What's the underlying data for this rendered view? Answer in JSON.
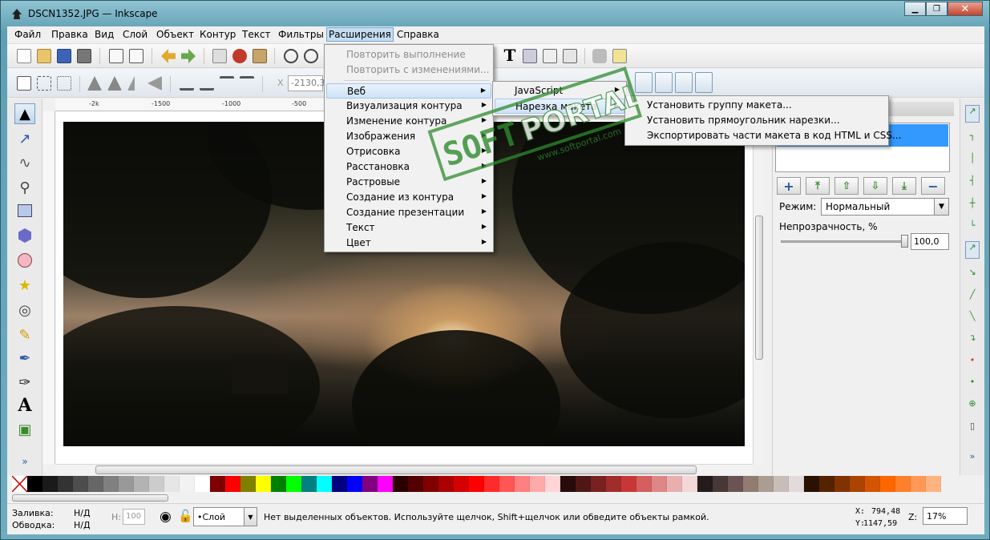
{
  "window": {
    "title": "DSCN1352.JPG — Inkscape",
    "minimize": "▁",
    "maximize": "❐",
    "close": "✕"
  },
  "menubar": [
    "Файл",
    "Правка",
    "Вид",
    "Слой",
    "Объект",
    "Контур",
    "Текст",
    "Фильтры",
    "Расширения",
    "Справка"
  ],
  "toolbar2": {
    "x_label": "X",
    "x_value": "-2130,3!"
  },
  "ruler": {
    "ticks": [
      "-2k",
      "-1500",
      "-1000",
      "-500"
    ]
  },
  "extensions_menu": {
    "items": [
      {
        "label": "Повторить выполнение",
        "disabled": true
      },
      {
        "label": "Повторить с изменениями...",
        "disabled": true
      },
      {
        "label": "Веб",
        "submenu": true
      },
      {
        "label": "Визуализация контура",
        "submenu": true
      },
      {
        "label": "Изменение контура",
        "submenu": true
      },
      {
        "label": "Изображения",
        "submenu": true
      },
      {
        "label": "Отрисовка",
        "submenu": true
      },
      {
        "label": "Расстановка",
        "submenu": true
      },
      {
        "label": "Растровые",
        "submenu": true
      },
      {
        "label": "Создание из контура",
        "submenu": true
      },
      {
        "label": "Создание презентации",
        "submenu": true
      },
      {
        "label": "Текст",
        "submenu": true
      },
      {
        "label": "Цвет",
        "submenu": true
      }
    ]
  },
  "web_submenu": {
    "items": [
      "JavaScript",
      "Нарезка макета"
    ]
  },
  "slicing_submenu": {
    "items": [
      "Установить группу макета...",
      "Установить прямоугольник нарезки...",
      "Экспортировать части макета в код HTML и CSS..."
    ]
  },
  "layers_panel": {
    "mode_label": "Режим:",
    "mode_value": "Нормальный",
    "opacity_label": "Непрозрачность, %",
    "opacity_value": "100,0",
    "opacity_fraction": 1.0,
    "buttons": [
      "+",
      "⤒",
      "⇧",
      "⇩",
      "⤓",
      "−"
    ]
  },
  "palette_colors": [
    "#000000",
    "#1a1a1a",
    "#333333",
    "#4d4d4d",
    "#666666",
    "#808080",
    "#999999",
    "#b3b3b3",
    "#cccccc",
    "#e6e6e6",
    "#f2f2f2",
    "#ffffff",
    "#800000",
    "#ff0000",
    "#808000",
    "#ffff00",
    "#008000",
    "#00ff00",
    "#008080",
    "#00ffff",
    "#000080",
    "#0000ff",
    "#800080",
    "#ff00ff",
    "#2b0000",
    "#550000",
    "#800000",
    "#aa0000",
    "#d40000",
    "#ff0000",
    "#ff2a2a",
    "#ff5555",
    "#ff8080",
    "#ffaaaa",
    "#ffd5d5",
    "#280b0b",
    "#501616",
    "#782121",
    "#a02c2c",
    "#c83737",
    "#d35f5f",
    "#de8787",
    "#e9afaf",
    "#f4d7d7",
    "#241c1c",
    "#483737",
    "#6c5353",
    "#917c6f",
    "#ac9d93",
    "#c8beb7",
    "#e3dbdb",
    "#2b1100",
    "#552200",
    "#803300",
    "#aa4400",
    "#d45500",
    "#ff6600",
    "#ff7f2a",
    "#ff9955",
    "#ffb380"
  ],
  "status": {
    "fill_label": "Заливка:",
    "fill_value": "Н/Д",
    "stroke_label": "Обводка:",
    "stroke_value": "Н/Д",
    "h_label": "H:",
    "h_value": "100",
    "layer_value": "•Слой",
    "message": "Нет выделенных объектов. Используйте щелчок, Shift+щелчок или обведите объекты рамкой.",
    "x_label": "X:",
    "x_value": "794,48",
    "y_label": "Y:",
    "y_value": "1147,59",
    "z_label": "Z:",
    "zoom_value": "17%"
  },
  "watermark": {
    "word1": "SOFT",
    "word2": "PORTAL",
    "sub": "www.softportal.com"
  },
  "chevron": "»"
}
